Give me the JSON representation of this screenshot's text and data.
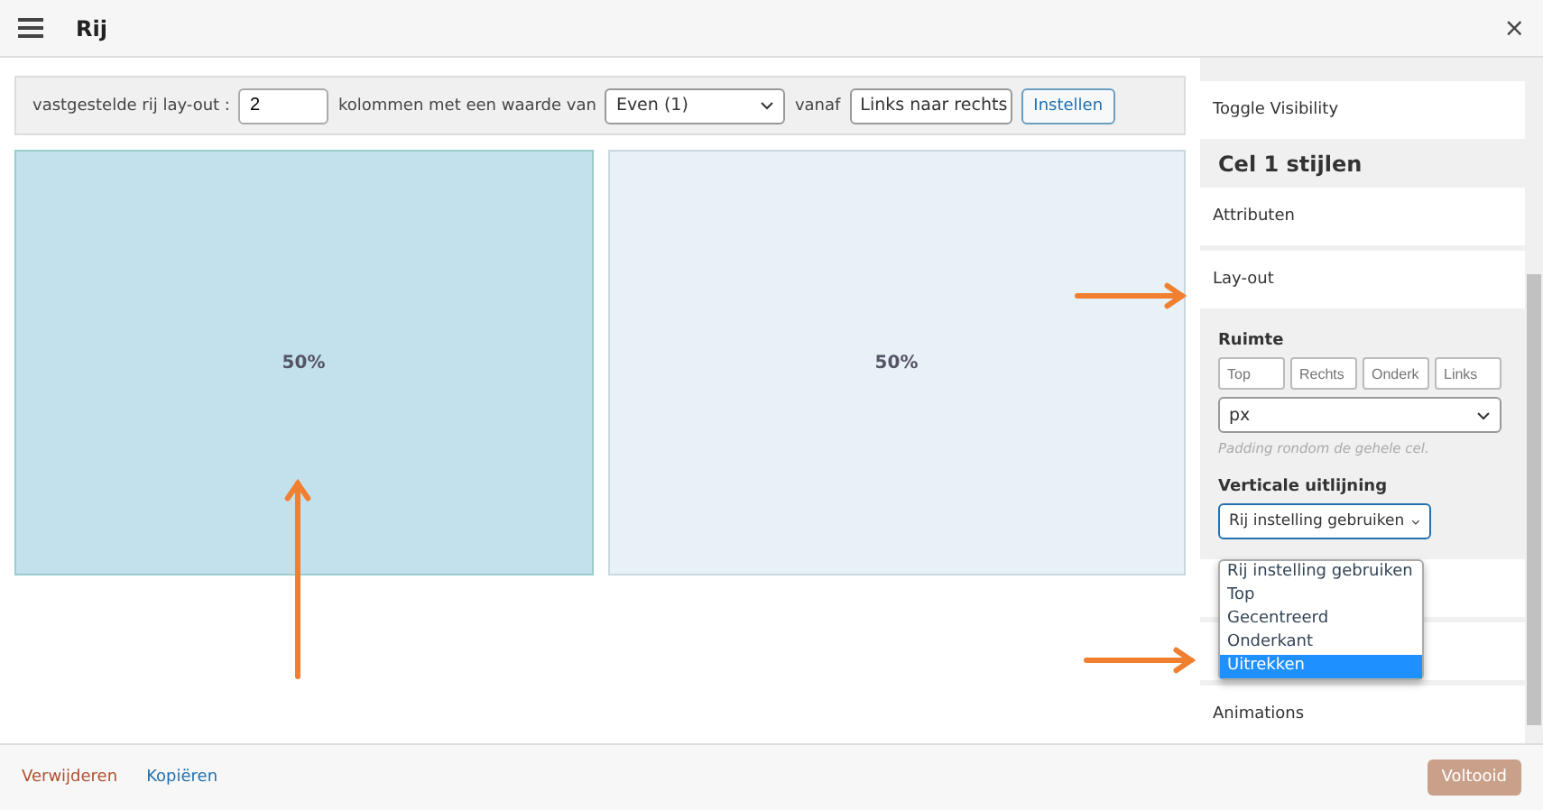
{
  "window": {
    "title": "Rij",
    "close": "×"
  },
  "toolbar": {
    "label": "vastgestelde rij lay-out :",
    "columns_value": "2",
    "middle_text": "kolommen met een waarde van",
    "ratio": "Even (1)",
    "from_text": "vanaf",
    "direction": "Links naar rechts",
    "button": "Instellen"
  },
  "cells": [
    {
      "label": "50%",
      "selected": true
    },
    {
      "label": "50%",
      "selected": false
    }
  ],
  "sidebar": {
    "items": [
      {
        "kind": "row",
        "label": "Toggle Visibility"
      },
      {
        "kind": "heading",
        "label": "Cel 1 stijlen"
      },
      {
        "kind": "row",
        "label": "Attributen"
      },
      {
        "kind": "row",
        "label": "Lay-out",
        "expanded": true
      },
      {
        "kind": "covered_row"
      },
      {
        "kind": "covered_row"
      },
      {
        "kind": "row",
        "label": "Animations"
      }
    ],
    "layout_panel": {
      "spacing_label": "Ruimte",
      "fields": [
        {
          "placeholder": "Top"
        },
        {
          "placeholder": "Rechts"
        },
        {
          "placeholder": "Onderk"
        },
        {
          "placeholder": "Links"
        }
      ],
      "unit": "px",
      "hint": "Padding rondom de gehele cel.",
      "align_label": "Verticale uitlijning",
      "align_value": "Rij instelling gebruiken",
      "options": [
        {
          "label": "Rij instelling gebruiken",
          "selected": false
        },
        {
          "label": "Top",
          "selected": false
        },
        {
          "label": "Gecentreerd",
          "selected": false
        },
        {
          "label": "Onderkant",
          "selected": false
        },
        {
          "label": "Uitrekken",
          "selected": true
        }
      ]
    }
  },
  "footer": {
    "delete": "Verwijderen",
    "copy": "Kopiëren",
    "done": "Voltooid"
  }
}
